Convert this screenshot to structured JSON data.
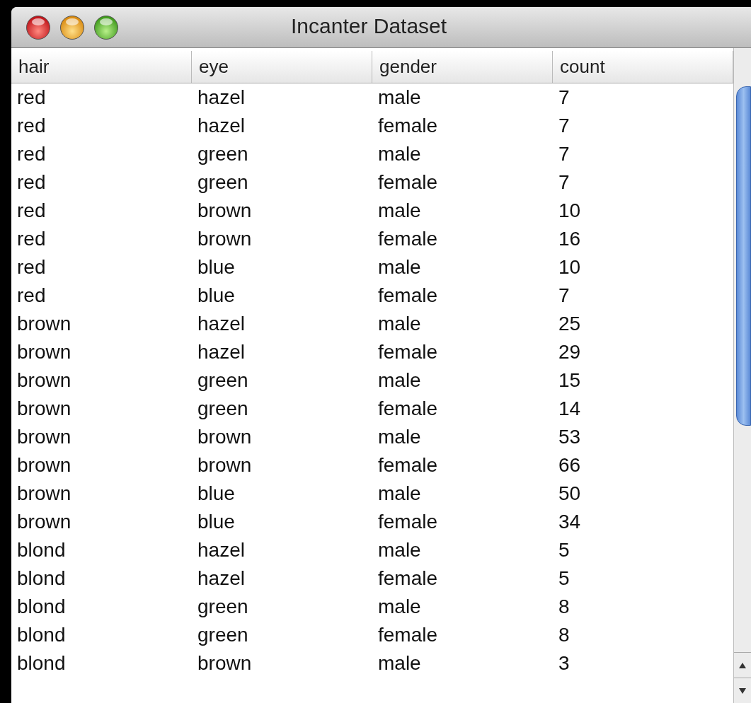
{
  "window": {
    "title": "Incanter Dataset"
  },
  "table": {
    "columns": [
      "hair",
      "eye",
      "gender",
      "count"
    ],
    "rows": [
      [
        "red",
        "hazel",
        "male",
        "7"
      ],
      [
        "red",
        "hazel",
        "female",
        "7"
      ],
      [
        "red",
        "green",
        "male",
        "7"
      ],
      [
        "red",
        "green",
        "female",
        "7"
      ],
      [
        "red",
        "brown",
        "male",
        "10"
      ],
      [
        "red",
        "brown",
        "female",
        "16"
      ],
      [
        "red",
        "blue",
        "male",
        "10"
      ],
      [
        "red",
        "blue",
        "female",
        "7"
      ],
      [
        "brown",
        "hazel",
        "male",
        "25"
      ],
      [
        "brown",
        "hazel",
        "female",
        "29"
      ],
      [
        "brown",
        "green",
        "male",
        "15"
      ],
      [
        "brown",
        "green",
        "female",
        "14"
      ],
      [
        "brown",
        "brown",
        "male",
        "53"
      ],
      [
        "brown",
        "brown",
        "female",
        "66"
      ],
      [
        "brown",
        "blue",
        "male",
        "50"
      ],
      [
        "brown",
        "blue",
        "female",
        "34"
      ],
      [
        "blond",
        "hazel",
        "male",
        "5"
      ],
      [
        "blond",
        "hazel",
        "female",
        "5"
      ],
      [
        "blond",
        "green",
        "male",
        "8"
      ],
      [
        "blond",
        "green",
        "female",
        "8"
      ],
      [
        "blond",
        "brown",
        "male",
        "3"
      ]
    ]
  }
}
